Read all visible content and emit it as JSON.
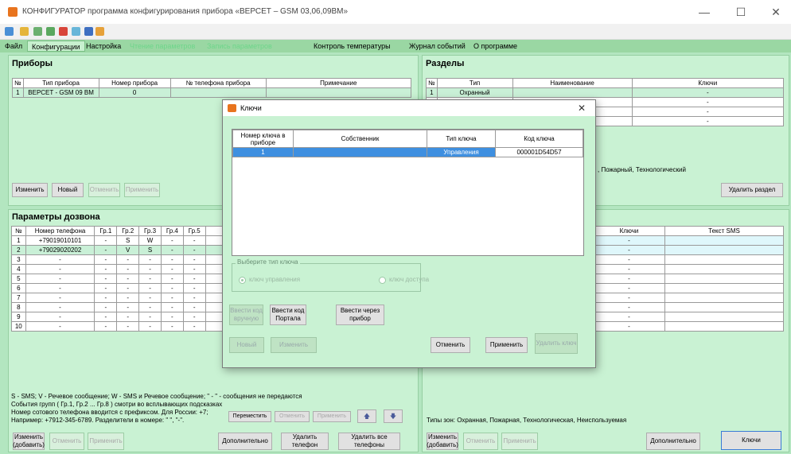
{
  "window": {
    "title": "КОНФИГУРАТОР программа конфигурирования прибора «ВЕРСЕТ – GSM 03,06,09ВМ»",
    "minimize": "—",
    "maximize": "☐",
    "close": "✕"
  },
  "menu": [
    {
      "label": "Файл"
    },
    {
      "label": "Конфигурации"
    },
    {
      "label": "Настройка"
    },
    {
      "label": "Чтение параметров"
    },
    {
      "label": "Запись параметров"
    },
    {
      "label": "Контроль температуры"
    },
    {
      "label": "Журнал событий"
    },
    {
      "label": "О программе"
    }
  ],
  "devices": {
    "title": "Приборы",
    "headers": [
      "№",
      "Тип прибора",
      "Номер прибора",
      "№ телефона прибора",
      "Примечание"
    ],
    "rows": [
      [
        "1",
        "ВЕРСЕТ - GSM 09 ВМ",
        "0",
        "",
        ""
      ]
    ],
    "buttons": {
      "edit": "Изменить",
      "new": "Новый",
      "cancel": "Отменить",
      "apply": "Применить"
    }
  },
  "sections": {
    "title": "Разделы",
    "headers": [
      "№",
      "Тип",
      "Наименование",
      "Ключи"
    ],
    "rows": [
      [
        "1",
        "Охранный",
        "",
        "-"
      ],
      [
        "",
        "",
        "",
        "-"
      ],
      [
        "",
        "",
        "",
        "-"
      ],
      [
        "",
        "",
        "",
        "-"
      ]
    ],
    "types_text": ", Пожарный, Технологический",
    "delete_button": "Удалить раздел"
  },
  "dialing": {
    "title": "Параметры дозвона",
    "headers": [
      "№",
      "Номер телефона",
      "Гр.1",
      "Гр.2",
      "Гр.3",
      "Гр.4",
      "Гр.5"
    ],
    "rows": [
      [
        "1",
        "+79019010101",
        "-",
        "S",
        "W",
        "-",
        "-"
      ],
      [
        "2",
        "+79029020202",
        "-",
        "V",
        "S",
        "-",
        "-"
      ],
      [
        "3",
        "-",
        "-",
        "-",
        "-",
        "-",
        "-"
      ],
      [
        "4",
        "-",
        "-",
        "-",
        "-",
        "-",
        "-"
      ],
      [
        "5",
        "-",
        "-",
        "-",
        "-",
        "-",
        "-"
      ],
      [
        "6",
        "-",
        "-",
        "-",
        "-",
        "-",
        "-"
      ],
      [
        "7",
        "-",
        "-",
        "-",
        "-",
        "-",
        "-"
      ],
      [
        "8",
        "-",
        "-",
        "-",
        "-",
        "-",
        "-"
      ],
      [
        "9",
        "-",
        "-",
        "-",
        "-",
        "-",
        "-"
      ],
      [
        "10",
        "-",
        "-",
        "-",
        "-",
        "-",
        "-"
      ]
    ],
    "notes": [
      "S - SMS;  V - Речевое сообщение;  W - SMS и Речевое сообщение; \" - \" - сообщения не передаются",
      "События групп ( Гр.1, Гр.2 ... Гр.8 ) смотри во всплывающих подсказках",
      "Номер сотового телефона вводится с префиксом. Для России: +7;",
      "Например: +7912-345-6789. Разделители в номере: \" \", \"-\"."
    ],
    "buttons": {
      "move": "Переместить",
      "cancel_small": "Отменить",
      "apply_small": "Применить",
      "up_arrow": "🡅",
      "down_arrow": "🡇",
      "edit_add": "Изменить (добавить)",
      "cancel": "Отменить",
      "apply": "Применить",
      "additional": "Дополнительно",
      "delete_phone": "Удалить телефон",
      "delete_all": "Удалить все телефоны"
    }
  },
  "zones": {
    "headers": [
      "Ключи",
      "Текст SMS"
    ],
    "rows": [
      "-",
      "-",
      "-",
      "-",
      "-",
      "-",
      "-",
      "-",
      "-",
      "-"
    ],
    "types_text": "Типы зон: Охранная, Пожарная, Технологическая, Неиспользуемая",
    "buttons": {
      "edit_add": "Изменить (добавить)",
      "cancel": "Отменить",
      "apply": "Применить",
      "additional": "Дополнительно",
      "keys": "Ключи"
    }
  },
  "keys_dialog": {
    "title": "Ключи",
    "close": "✕",
    "headers": [
      "Номер ключа в приборе",
      "Собственник",
      "Тип ключа",
      "Код ключа"
    ],
    "rows": [
      [
        "1",
        "",
        "Управления",
        "000001D54D57"
      ]
    ],
    "group_label": "Выберите тип ключа",
    "radio_control": "ключ управления",
    "radio_access": "ключ доступа",
    "buttons": {
      "enter_manual": "Ввести код вручную",
      "enter_portal": "Ввести код Портала",
      "enter_device": "Ввести через прибор",
      "new": "Новый",
      "edit": "Изменить",
      "cancel": "Отменить",
      "apply": "Применить",
      "delete_key": "Удалить ключ"
    }
  },
  "colors": {
    "background": "#b3e6c0",
    "panel": "#c9f2d3",
    "selection": "#3e8fe0",
    "menu_bar": "#9ad7a3"
  }
}
